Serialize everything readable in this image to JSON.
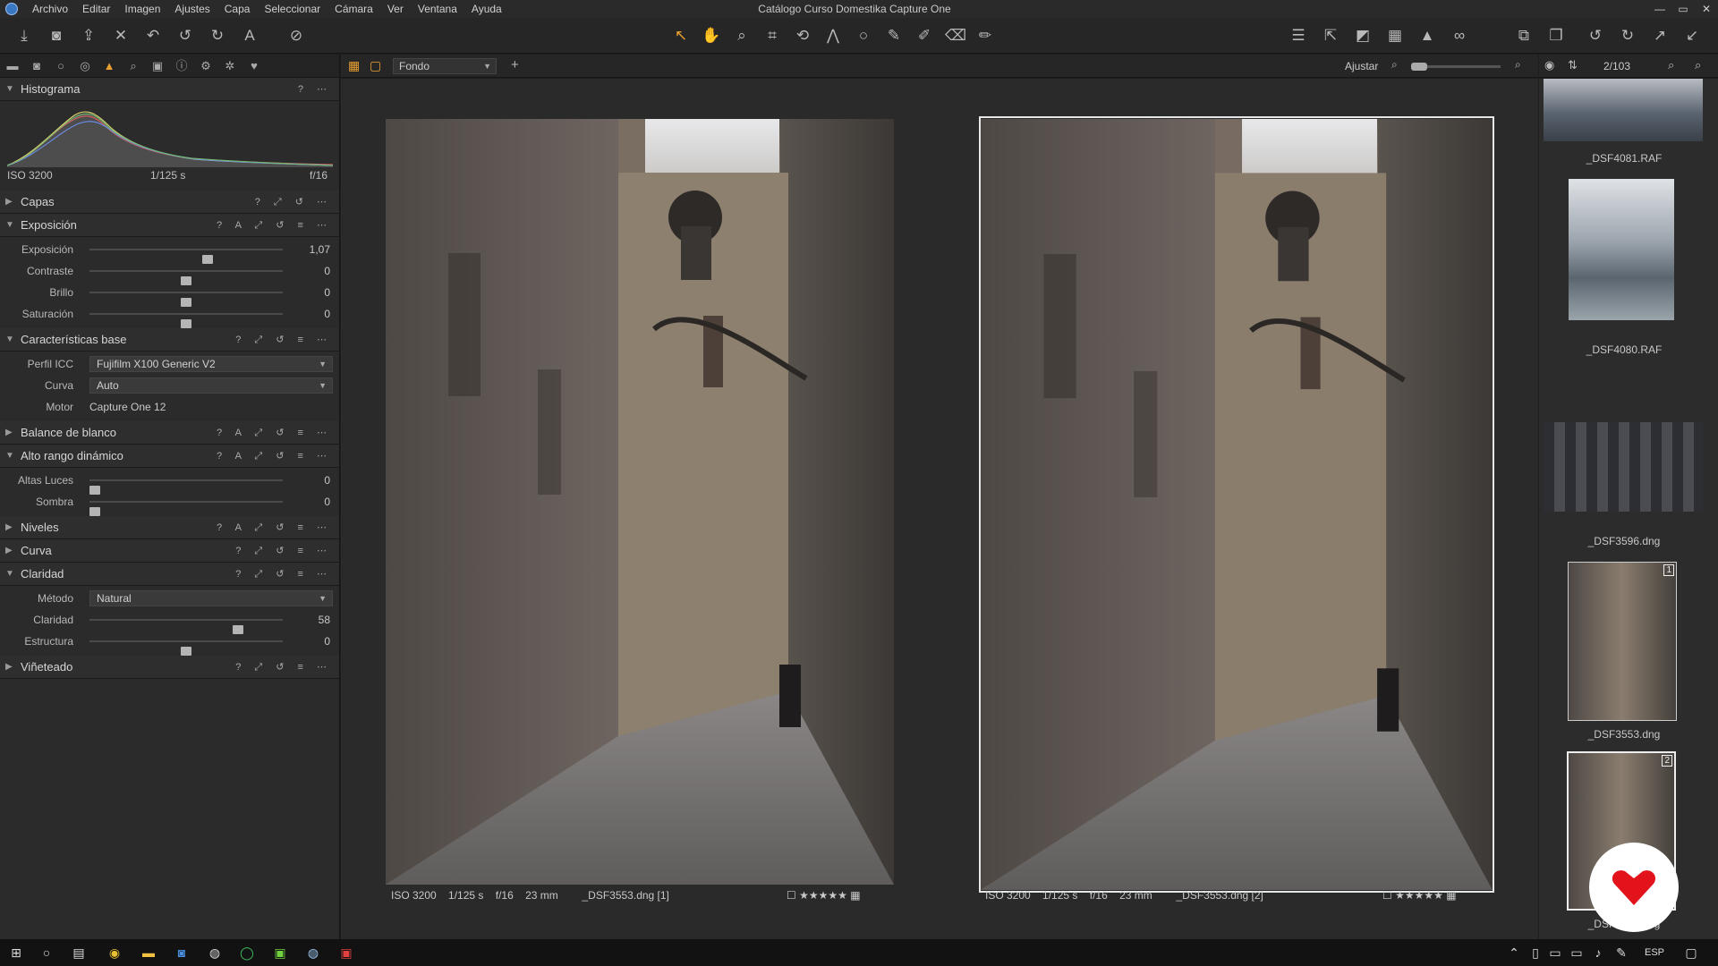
{
  "app": {
    "title": "Catálogo Curso Domestika Capture One",
    "menu": [
      "Archivo",
      "Editar",
      "Imagen",
      "Ajustes",
      "Capa",
      "Seleccionar",
      "Cámara",
      "Ver",
      "Ventana",
      "Ayuda"
    ],
    "window_controls": [
      "—",
      "▭",
      "✕"
    ]
  },
  "toolbar": {
    "left_icons": [
      "import-icon",
      "camera-icon",
      "export-icon",
      "delete-icon",
      "undo-icon",
      "undo-step-icon",
      "redo-icon",
      "text-icon",
      "no-edit-icon"
    ],
    "center_icons": [
      "select-cursor-icon",
      "hand-pan-icon",
      "loupe-icon",
      "crop-icon",
      "rotate-icon",
      "keystone-icon",
      "spot-icon",
      "brush-icon",
      "pen-icon",
      "eraser-icon",
      "gradient-icon"
    ],
    "right_icons": [
      "layout-icon",
      "export-share-icon",
      "proof-icon",
      "grid-icon",
      "warning-icon",
      "glasses-icon",
      "compare-icon",
      "stack-icon",
      "rotate-left-icon",
      "rotate-right-icon",
      "expand-icon",
      "collapse-icon"
    ]
  },
  "left_panel": {
    "tool_tabs": [
      "folder-icon",
      "camera-icon",
      "lens-icon",
      "color-icon",
      "exposure-icon",
      "details-icon",
      "metadata-icon",
      "info-icon",
      "gear-icon",
      "styles-icon",
      "heart-icon"
    ],
    "histogram": {
      "title": "Histograma",
      "help": "?",
      "more": "⋯",
      "iso": "ISO 3200",
      "shutter": "1/125 s",
      "aperture": "f/16"
    },
    "capas": {
      "title": "Capas",
      "actions": "? ⤢ ↺ ⋯"
    },
    "exposicion": {
      "title": "Exposición",
      "actions": "? A ⤢ ↺ ≡ ⋯",
      "sliders": [
        {
          "label": "Exposición",
          "value": "1,07",
          "pos": 0.61
        },
        {
          "label": "Contraste",
          "value": "0",
          "pos": 0.5
        },
        {
          "label": "Brillo",
          "value": "0",
          "pos": 0.5
        },
        {
          "label": "Saturación",
          "value": "0",
          "pos": 0.5
        }
      ]
    },
    "caracteristicas": {
      "title": "Características base",
      "actions": "? ⤢ ↺ ≡ ⋯",
      "perfil_label": "Perfil ICC",
      "perfil_value": "Fujifilm X100 Generic V2",
      "curva_label": "Curva",
      "curva_value": "Auto",
      "motor_label": "Motor",
      "motor_value": "Capture One 12"
    },
    "balance": {
      "title": "Balance de blanco",
      "actions": "? A ⤢ ↺ ≡ ⋯"
    },
    "hdr": {
      "title": "Alto rango dinámico",
      "actions": "? A ⤢ ↺ ≡ ⋯",
      "sliders": [
        {
          "label": "Altas Luces",
          "value": "0",
          "pos": 0.03
        },
        {
          "label": "Sombra",
          "value": "0",
          "pos": 0.03
        }
      ]
    },
    "niveles": {
      "title": "Niveles",
      "actions": "? A ⤢ ↺ ≡ ⋯"
    },
    "curva": {
      "title": "Curva",
      "actions": "? ⤢ ↺ ≡ ⋯"
    },
    "claridad": {
      "title": "Claridad",
      "actions": "? ⤢ ↺ ≡ ⋯",
      "metodo_label": "Método",
      "metodo_value": "Natural",
      "sliders": [
        {
          "label": "Claridad",
          "value": "58",
          "pos": 0.77
        },
        {
          "label": "Estructura",
          "value": "0",
          "pos": 0.5
        }
      ]
    },
    "vineteado": {
      "title": "Viñeteado",
      "actions": "? ⤢ ↺ ≡ ⋯"
    }
  },
  "viewer_bar": {
    "style_value": "Fondo",
    "ajustar": "Ajustar",
    "counter": "2/103"
  },
  "viewer": {
    "left": {
      "iso": "ISO 3200",
      "shutter": "1/125 s",
      "aperture": "f/16",
      "focal": "23 mm",
      "filename": "_DSF3553.dng [1]",
      "rating": "☐ ★★★★★ ▦"
    },
    "right": {
      "iso": "ISO 3200",
      "shutter": "1/125 s",
      "aperture": "f/16",
      "focal": "23 mm",
      "filename": "_DSF3553.dng [2]",
      "rating": "☐ ★★★★★ ▦"
    }
  },
  "browser": {
    "thumbs": [
      {
        "name": "_DSF4081.RAF"
      },
      {
        "name": "_DSF4080.RAF"
      },
      {
        "name": "_DSF3596.dng"
      },
      {
        "name": "_DSF3553.dng",
        "badge": "1"
      },
      {
        "name": "_DSF3553.dng",
        "badge": "2"
      }
    ]
  },
  "taskbar": {
    "lang": "ESP"
  },
  "colors": {
    "accent": "#e8a030",
    "logo_red": "#e3131b"
  }
}
